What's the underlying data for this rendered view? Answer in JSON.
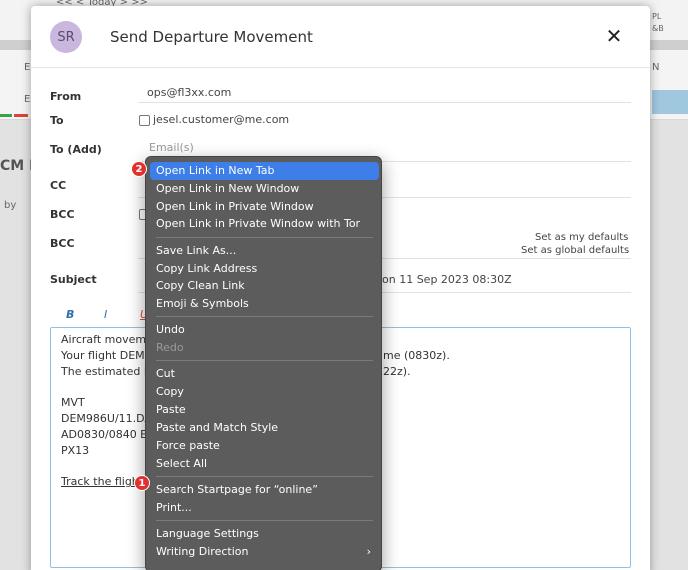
{
  "background": {
    "top_nav": "<<  < Today  >  >>",
    "right_top": "PL",
    "right_top2": "&B",
    "partial_heading": "CM M",
    "partial_by": "by",
    "partial_e1": "E",
    "partial_e2": "E",
    "right_n": "N"
  },
  "modal": {
    "avatar_initials": "SR",
    "title": "Send Departure Movement",
    "close_label": "✕"
  },
  "form": {
    "from_label": "From",
    "from_value": "ops@fl3xx.com",
    "to_label": "To",
    "to_value": "jesel.customer@me.com",
    "to_add_label": "To (Add)",
    "to_add_placeholder": "Email(s)",
    "cc_label": "CC",
    "bcc_label": "BCC",
    "bcc2_label": "BCC",
    "set_defaults": "Set as my defaults",
    "set_global_defaults": "Set as global defaults",
    "subject_label": "Subject",
    "subject_tail": "on 11 Sep 2023 08:30Z"
  },
  "toolbar": {
    "bold": "B",
    "italic": "I",
    "underline": "U"
  },
  "editor": {
    "line1": "Aircraft moveme",
    "line2": "Your flight DEM9",
    "line2_tail": "me (0830z).",
    "line3": "The estimated la",
    "line3_tail": "22z).",
    "line4": "MVT",
    "line5": "DEM986U/11.DA",
    "line6": "AD0830/0840 EA",
    "line7": "PX13",
    "link_text": "Track the flight "
  },
  "context_menu": {
    "items": [
      {
        "label": "Open Link in New Tab"
      },
      {
        "label": "Open Link in New Window"
      },
      {
        "label": "Open Link in Private Window"
      },
      {
        "label": "Open Link in Private Window with Tor"
      },
      {
        "label": "Save Link As..."
      },
      {
        "label": "Copy Link Address"
      },
      {
        "label": "Copy Clean Link"
      },
      {
        "label": "Emoji & Symbols"
      },
      {
        "label": "Undo"
      },
      {
        "label": "Redo"
      },
      {
        "label": "Cut"
      },
      {
        "label": "Copy"
      },
      {
        "label": "Paste"
      },
      {
        "label": "Paste and Match Style"
      },
      {
        "label": "Force paste"
      },
      {
        "label": "Select All"
      },
      {
        "label": "Search Startpage for “online”"
      },
      {
        "label": "Print..."
      },
      {
        "label": "Language Settings"
      },
      {
        "label": "Writing Direction"
      }
    ],
    "submenu_arrow": "›"
  },
  "badges": {
    "step1": "1",
    "step2": "2"
  },
  "colors": {
    "highlight": "#3d7ee9",
    "menu_bg": "#5c5c5c",
    "badge": "#e0312f",
    "avatar": "#c9b7de"
  }
}
